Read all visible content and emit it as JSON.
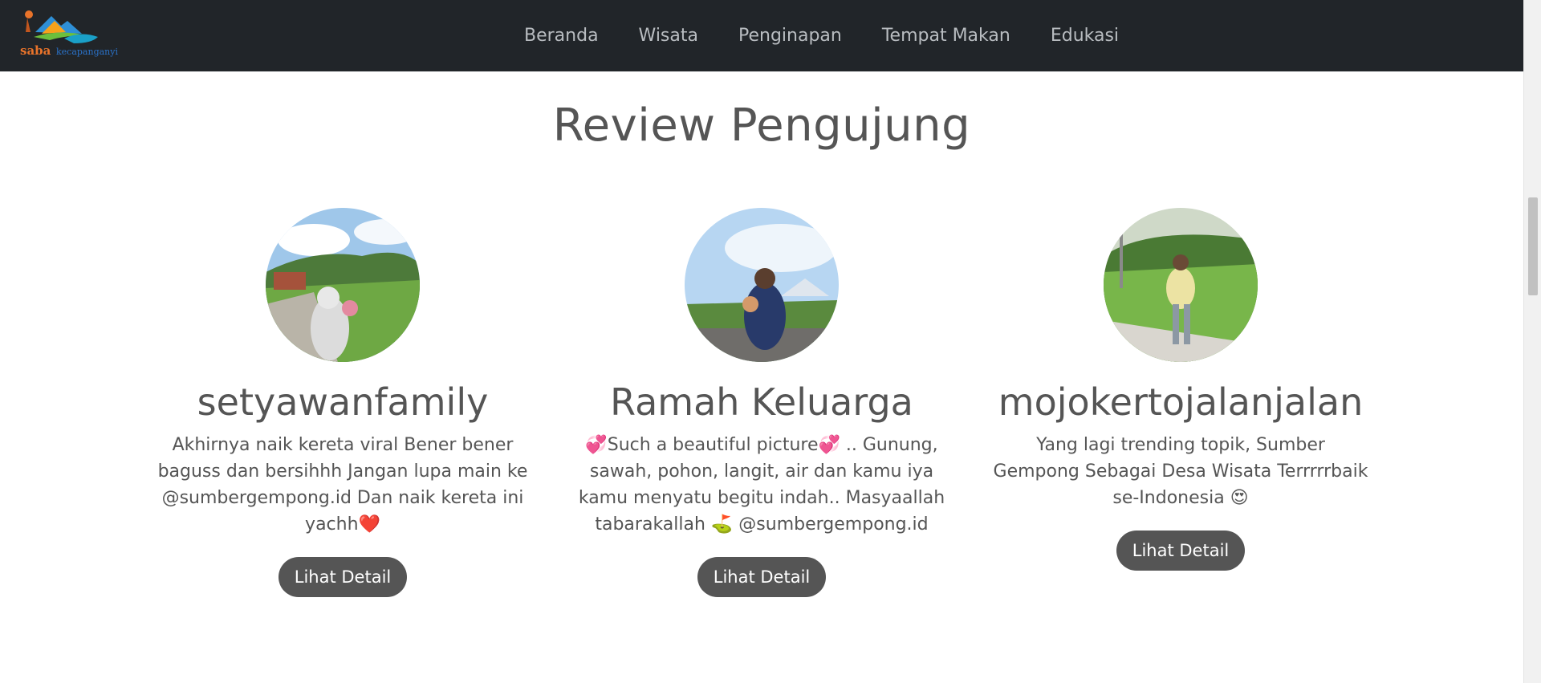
{
  "navbar": {
    "logo_text": "saba",
    "logo_subtext": "kecapanganyi",
    "items": [
      "Beranda",
      "Wisata",
      "Penginapan",
      "Tempat Makan",
      "Edukasi"
    ]
  },
  "section": {
    "title": "Review Pengujung"
  },
  "reviews": [
    {
      "name": "setyawanfamily",
      "text": "Akhirnya naik kereta viral Bener bener baguss dan bersihhh Jangan lupa main ke @sumbergempong.id Dan naik kereta ini yachh❤️",
      "button": "Lihat Detail"
    },
    {
      "name": "Ramah Keluarga",
      "text": "💞Such a beautiful picture💞 .. Gunung, sawah, pohon, langit, air dan kamu iya kamu menyatu begitu indah.. Masyaallah tabarakallah ⛳ @sumbergempong.id",
      "button": "Lihat Detail"
    },
    {
      "name": "mojokertojalanjalan",
      "text": "Yang lagi trending topik, Sumber Gempong Sebagai Desa Wisata Terrrrrbaik se-Indonesia 😍",
      "button": "Lihat Detail"
    }
  ]
}
